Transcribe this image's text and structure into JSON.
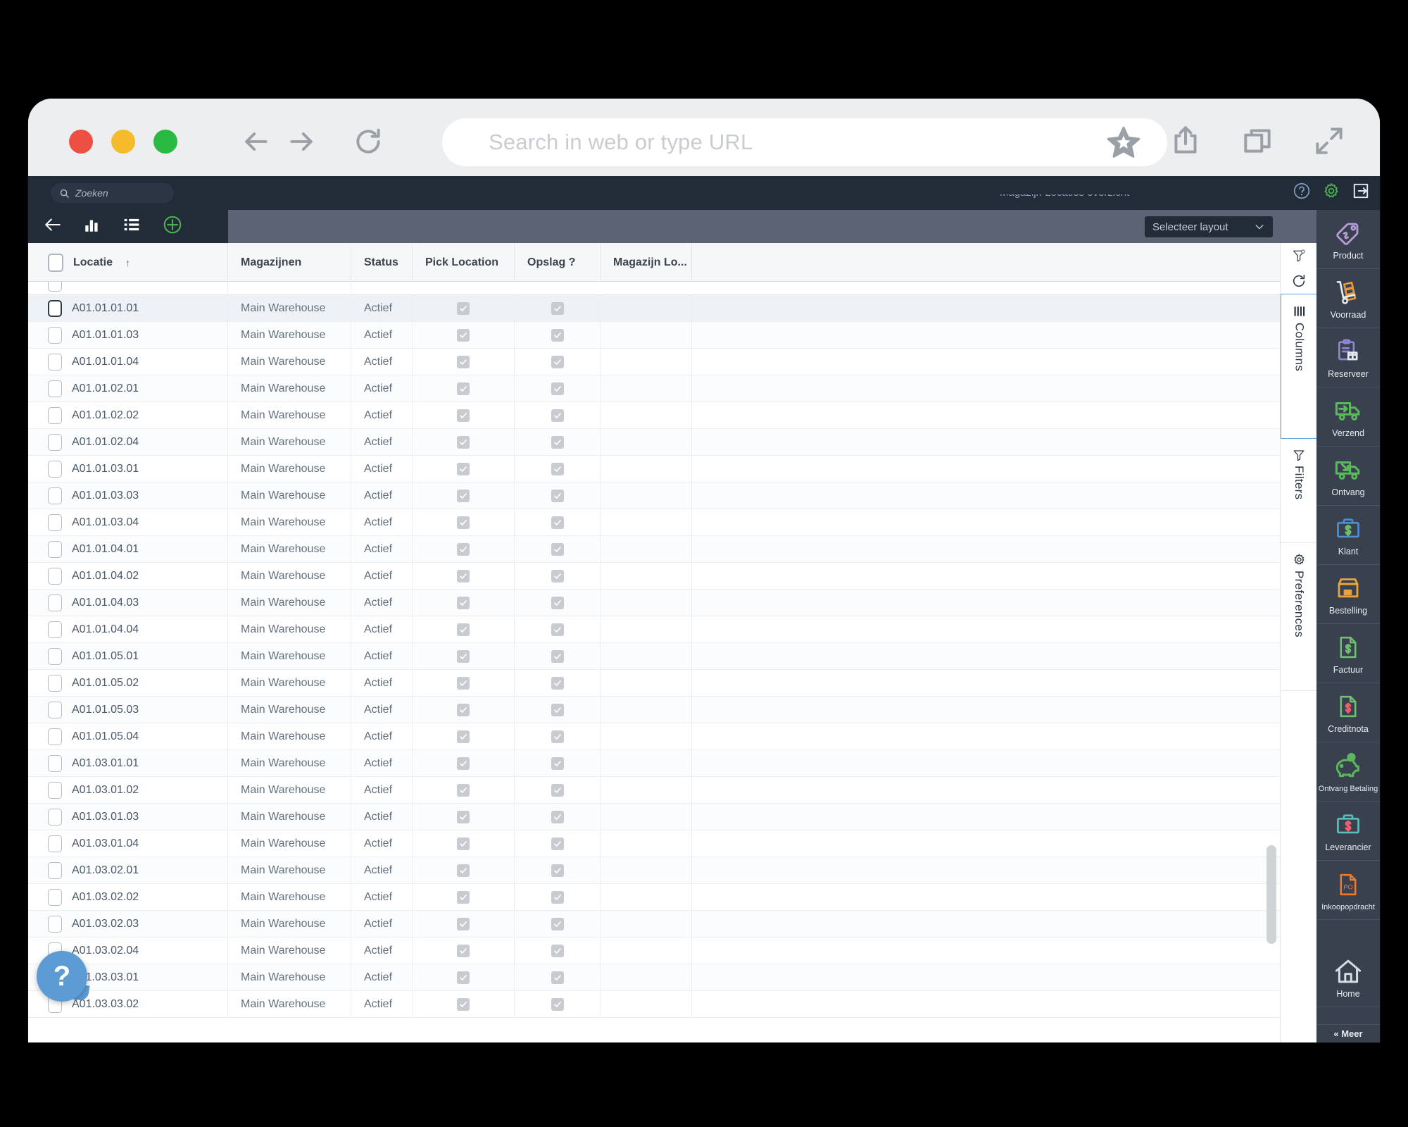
{
  "browser": {
    "window_buttons": [
      "close",
      "minimize",
      "maximize"
    ],
    "url_placeholder": "Search in web or type URL",
    "back_icon": "back-arrow-icon",
    "forward_icon": "forward-arrow-icon",
    "reload_icon": "reload-icon",
    "bookmark_icon": "star-icon",
    "share_icon": "share-icon",
    "tabs_icon": "copy-tabs-icon",
    "fullscreen_icon": "expand-icon"
  },
  "appbar": {
    "search_placeholder": "Zoeken",
    "search_icon": "magnifier-icon",
    "help_icon": "question-circle-icon",
    "settings_icon": "gear-icon",
    "logout_icon": "logout-icon",
    "clipped_text": "Magazijn Locaties overzicht"
  },
  "toolbar": {
    "back_icon": "back-arrow-icon",
    "chart_icon": "bar-chart-icon",
    "list_icon": "list-icon",
    "add_icon": "plus-circle-icon",
    "layout_select_label": "Selecteer layout",
    "layout_select_caret": "chevron-down-icon"
  },
  "sidepanel": {
    "clear_filter_icon": "filter-clear-icon",
    "refresh_icon": "refresh-icon",
    "tabs": [
      {
        "label": "Columns",
        "icon": "columns-icon",
        "active": true
      },
      {
        "label": "Filters",
        "icon": "funnel-icon",
        "active": false
      },
      {
        "label": "Preferences",
        "icon": "gear-icon",
        "active": false
      }
    ]
  },
  "table": {
    "columns": [
      {
        "key": "locatie",
        "label": "Locatie",
        "sort": "↑"
      },
      {
        "key": "magazijnen",
        "label": "Magazijnen"
      },
      {
        "key": "status",
        "label": "Status"
      },
      {
        "key": "pick_location",
        "label": "Pick Location"
      },
      {
        "key": "opslag",
        "label": "Opslag ?"
      },
      {
        "key": "magazijn_lo",
        "label": "Magazijn Lo..."
      }
    ],
    "rows": [
      {
        "locatie": "A01.01.01.01",
        "magazijnen": "Main Warehouse",
        "status": "Actief",
        "pick_location": true,
        "opslag": true,
        "selected": true
      },
      {
        "locatie": "A01.01.01.03",
        "magazijnen": "Main Warehouse",
        "status": "Actief",
        "pick_location": true,
        "opslag": true
      },
      {
        "locatie": "A01.01.01.04",
        "magazijnen": "Main Warehouse",
        "status": "Actief",
        "pick_location": true,
        "opslag": true
      },
      {
        "locatie": "A01.01.02.01",
        "magazijnen": "Main Warehouse",
        "status": "Actief",
        "pick_location": true,
        "opslag": true
      },
      {
        "locatie": "A01.01.02.02",
        "magazijnen": "Main Warehouse",
        "status": "Actief",
        "pick_location": true,
        "opslag": true
      },
      {
        "locatie": "A01.01.02.04",
        "magazijnen": "Main Warehouse",
        "status": "Actief",
        "pick_location": true,
        "opslag": true
      },
      {
        "locatie": "A01.01.03.01",
        "magazijnen": "Main Warehouse",
        "status": "Actief",
        "pick_location": true,
        "opslag": true
      },
      {
        "locatie": "A01.01.03.03",
        "magazijnen": "Main Warehouse",
        "status": "Actief",
        "pick_location": true,
        "opslag": true
      },
      {
        "locatie": "A01.01.03.04",
        "magazijnen": "Main Warehouse",
        "status": "Actief",
        "pick_location": true,
        "opslag": true
      },
      {
        "locatie": "A01.01.04.01",
        "magazijnen": "Main Warehouse",
        "status": "Actief",
        "pick_location": true,
        "opslag": true
      },
      {
        "locatie": "A01.01.04.02",
        "magazijnen": "Main Warehouse",
        "status": "Actief",
        "pick_location": true,
        "opslag": true
      },
      {
        "locatie": "A01.01.04.03",
        "magazijnen": "Main Warehouse",
        "status": "Actief",
        "pick_location": true,
        "opslag": true
      },
      {
        "locatie": "A01.01.04.04",
        "magazijnen": "Main Warehouse",
        "status": "Actief",
        "pick_location": true,
        "opslag": true
      },
      {
        "locatie": "A01.01.05.01",
        "magazijnen": "Main Warehouse",
        "status": "Actief",
        "pick_location": true,
        "opslag": true
      },
      {
        "locatie": "A01.01.05.02",
        "magazijnen": "Main Warehouse",
        "status": "Actief",
        "pick_location": true,
        "opslag": true
      },
      {
        "locatie": "A01.01.05.03",
        "magazijnen": "Main Warehouse",
        "status": "Actief",
        "pick_location": true,
        "opslag": true
      },
      {
        "locatie": "A01.01.05.04",
        "magazijnen": "Main Warehouse",
        "status": "Actief",
        "pick_location": true,
        "opslag": true
      },
      {
        "locatie": "A01.03.01.01",
        "magazijnen": "Main Warehouse",
        "status": "Actief",
        "pick_location": true,
        "opslag": true
      },
      {
        "locatie": "A01.03.01.02",
        "magazijnen": "Main Warehouse",
        "status": "Actief",
        "pick_location": true,
        "opslag": true
      },
      {
        "locatie": "A01.03.01.03",
        "magazijnen": "Main Warehouse",
        "status": "Actief",
        "pick_location": true,
        "opslag": true
      },
      {
        "locatie": "A01.03.01.04",
        "magazijnen": "Main Warehouse",
        "status": "Actief",
        "pick_location": true,
        "opslag": true
      },
      {
        "locatie": "A01.03.02.01",
        "magazijnen": "Main Warehouse",
        "status": "Actief",
        "pick_location": true,
        "opslag": true
      },
      {
        "locatie": "A01.03.02.02",
        "magazijnen": "Main Warehouse",
        "status": "Actief",
        "pick_location": true,
        "opslag": true
      },
      {
        "locatie": "A01.03.02.03",
        "magazijnen": "Main Warehouse",
        "status": "Actief",
        "pick_location": true,
        "opslag": true
      },
      {
        "locatie": "A01.03.02.04",
        "magazijnen": "Main Warehouse",
        "status": "Actief",
        "pick_location": true,
        "opslag": true
      },
      {
        "locatie": "A01.03.03.01",
        "magazijnen": "Main Warehouse",
        "status": "Actief",
        "pick_location": true,
        "opslag": true
      },
      {
        "locatie": "A01.03.03.02",
        "magazijnen": "Main Warehouse",
        "status": "Actief",
        "pick_location": true,
        "opslag": true
      }
    ]
  },
  "rightbar": {
    "items": [
      {
        "label": "Product",
        "icon": "price-tag-icon",
        "color": "#b79bd6"
      },
      {
        "label": "Voorraad",
        "icon": "hand-truck-icon",
        "color": "#e79a3c"
      },
      {
        "label": "Reserveer",
        "icon": "clipboard-box-icon",
        "color": "#8f85d4"
      },
      {
        "label": "Verzend",
        "icon": "truck-out-icon",
        "color": "#5cb85c"
      },
      {
        "label": "Ontvang",
        "icon": "truck-in-icon",
        "color": "#5cb85c"
      },
      {
        "label": "Klant",
        "icon": "briefcase-dollar-icon",
        "color": "#4a90d9"
      },
      {
        "label": "Bestelling",
        "icon": "box-order-icon",
        "color": "#e8a33d"
      },
      {
        "label": "Factuur",
        "icon": "invoice-dollar-icon",
        "color": "#6fc06f"
      },
      {
        "label": "Creditnota",
        "icon": "credit-note-icon",
        "color": "#6fc06f"
      },
      {
        "label": "Ontvang Betaling",
        "icon": "piggy-bank-icon",
        "color": "#5cb85c"
      },
      {
        "label": "Leverancier",
        "icon": "briefcase-supplier-icon",
        "color": "#5bc0bd"
      },
      {
        "label": "Inkoopopdracht",
        "icon": "purchase-order-icon",
        "color": "#ef7a2b"
      },
      {
        "label": "Home",
        "icon": "home-icon",
        "color": "#d8dde3"
      }
    ],
    "more_label": "« Meer"
  },
  "help": {
    "icon": "question-mark-icon",
    "label": "?"
  },
  "colors": {
    "appbar_bg": "#222b38",
    "toolbar_bg": "#5b6375",
    "sidebar_bg": "#39414f",
    "accent_green": "#4caf50",
    "accent_blue": "#64a6e0"
  }
}
